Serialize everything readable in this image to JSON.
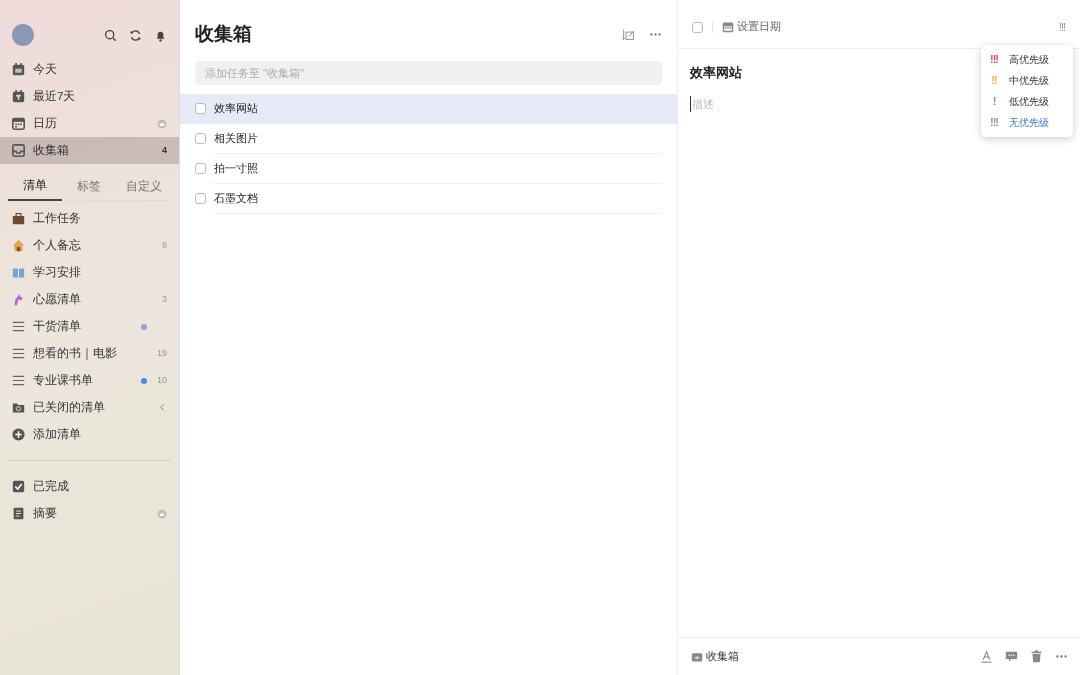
{
  "sidebar": {
    "smart_lists": [
      {
        "label": "今天",
        "selected": false
      },
      {
        "label": "最近7天",
        "selected": false
      },
      {
        "label": "日历",
        "selected": false,
        "pro": true
      },
      {
        "label": "收集箱",
        "selected": true,
        "count": "4"
      }
    ],
    "tabs": [
      {
        "label": "清单",
        "selected": true
      },
      {
        "label": "标签",
        "selected": false
      },
      {
        "label": "自定义",
        "selected": false
      }
    ],
    "lists": [
      {
        "label": "工作任务",
        "kind": "emoji"
      },
      {
        "label": "个人备忘",
        "kind": "emoji",
        "count": "8"
      },
      {
        "label": "学习安排",
        "kind": "emoji"
      },
      {
        "label": "心愿清单",
        "kind": "emoji",
        "count": "3"
      },
      {
        "label": "干货清单",
        "kind": "list",
        "color": "#8fa3d6"
      },
      {
        "label": "想看的书｜电影",
        "kind": "list",
        "count": "19"
      },
      {
        "label": "专业课书单",
        "kind": "list",
        "color": "#4f86f7",
        "count": "10"
      },
      {
        "label": "已关闭的清单",
        "kind": "closed"
      },
      {
        "label": "添加清单",
        "kind": "add"
      }
    ],
    "bottom": [
      {
        "label": "已完成"
      },
      {
        "label": "摘要",
        "pro": true
      }
    ]
  },
  "task_list": {
    "title": "收集箱",
    "add_field": {
      "placeholder": "添加任务至 \"收集箱\""
    },
    "tasks": [
      {
        "title": "效率网站",
        "checked": false,
        "selected": true
      },
      {
        "title": "相关图片",
        "checked": false,
        "selected": false
      },
      {
        "title": "拍一寸照",
        "checked": false,
        "selected": false
      },
      {
        "title": "石墨文档",
        "checked": false,
        "selected": false
      }
    ]
  },
  "detail": {
    "checked": false,
    "date_label": "设置日期",
    "priority_button": "!!!",
    "title": "效率网站",
    "description": {
      "placeholder": "描述"
    },
    "list_name": "收集箱"
  },
  "priority_menu": [
    {
      "mark": "!!!",
      "label": "高优先级",
      "color": "#e8436a",
      "selected": false
    },
    {
      "mark": "!!",
      "label": "中优先级",
      "color": "#f5b530",
      "selected": false
    },
    {
      "mark": "!",
      "label": "低优先级",
      "color": "#6f8fe0",
      "selected": false
    },
    {
      "mark": "!!!",
      "label": "无优先级",
      "color": "#9a9a9a",
      "selected": true
    }
  ]
}
